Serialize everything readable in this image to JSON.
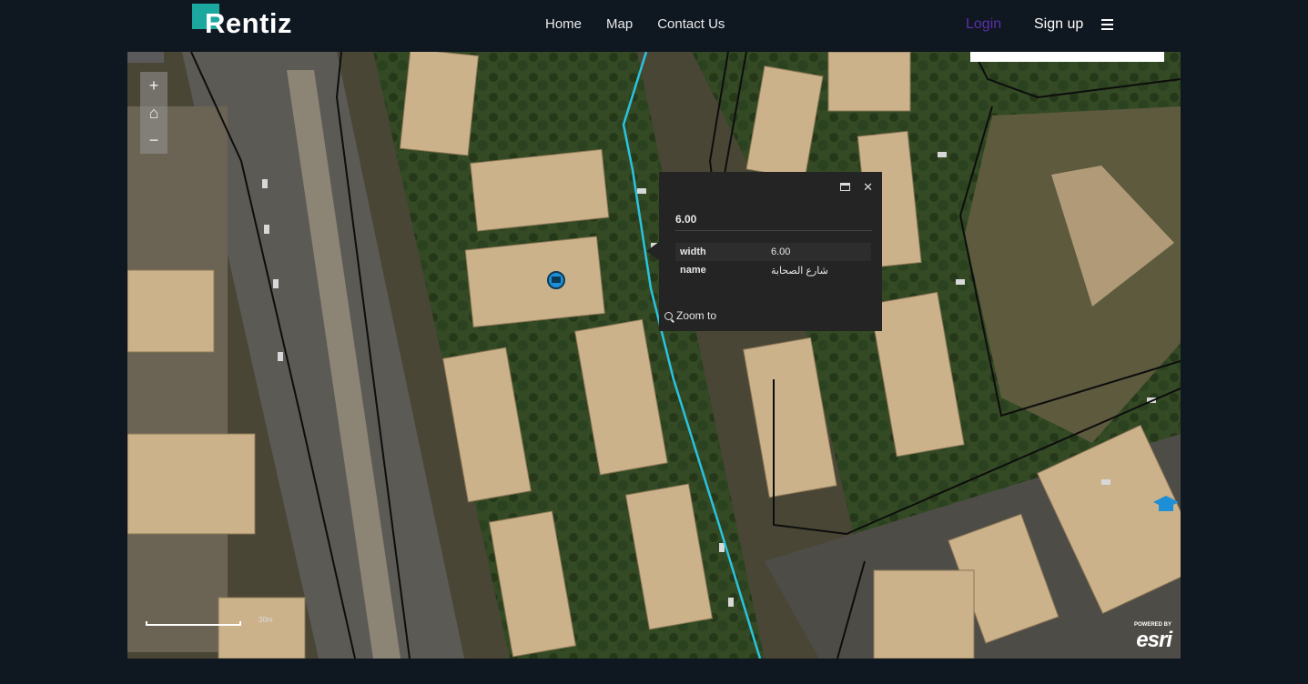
{
  "header": {
    "logo_text": "Rentiz",
    "nav": [
      "Home",
      "Map",
      "Contact Us"
    ],
    "login": "Login",
    "signup": "Sign up"
  },
  "map": {
    "zoom_in": "+",
    "home": "⌂",
    "zoom_out": "−",
    "scale_label": "30m",
    "attribution_small": "POWERED BY",
    "attribution": "esri"
  },
  "popup": {
    "title": "6.00",
    "rows": [
      {
        "key": "width",
        "value": "6.00"
      },
      {
        "key": "name",
        "value": "شارع الصحابة"
      }
    ],
    "zoom_to": "Zoom to",
    "close": "✕"
  },
  "colors": {
    "brand_teal": "#1aa89f",
    "login_purple": "#5b2fa8",
    "highlight_road": "#2bc3e0",
    "header_bg": "#0f1720"
  }
}
